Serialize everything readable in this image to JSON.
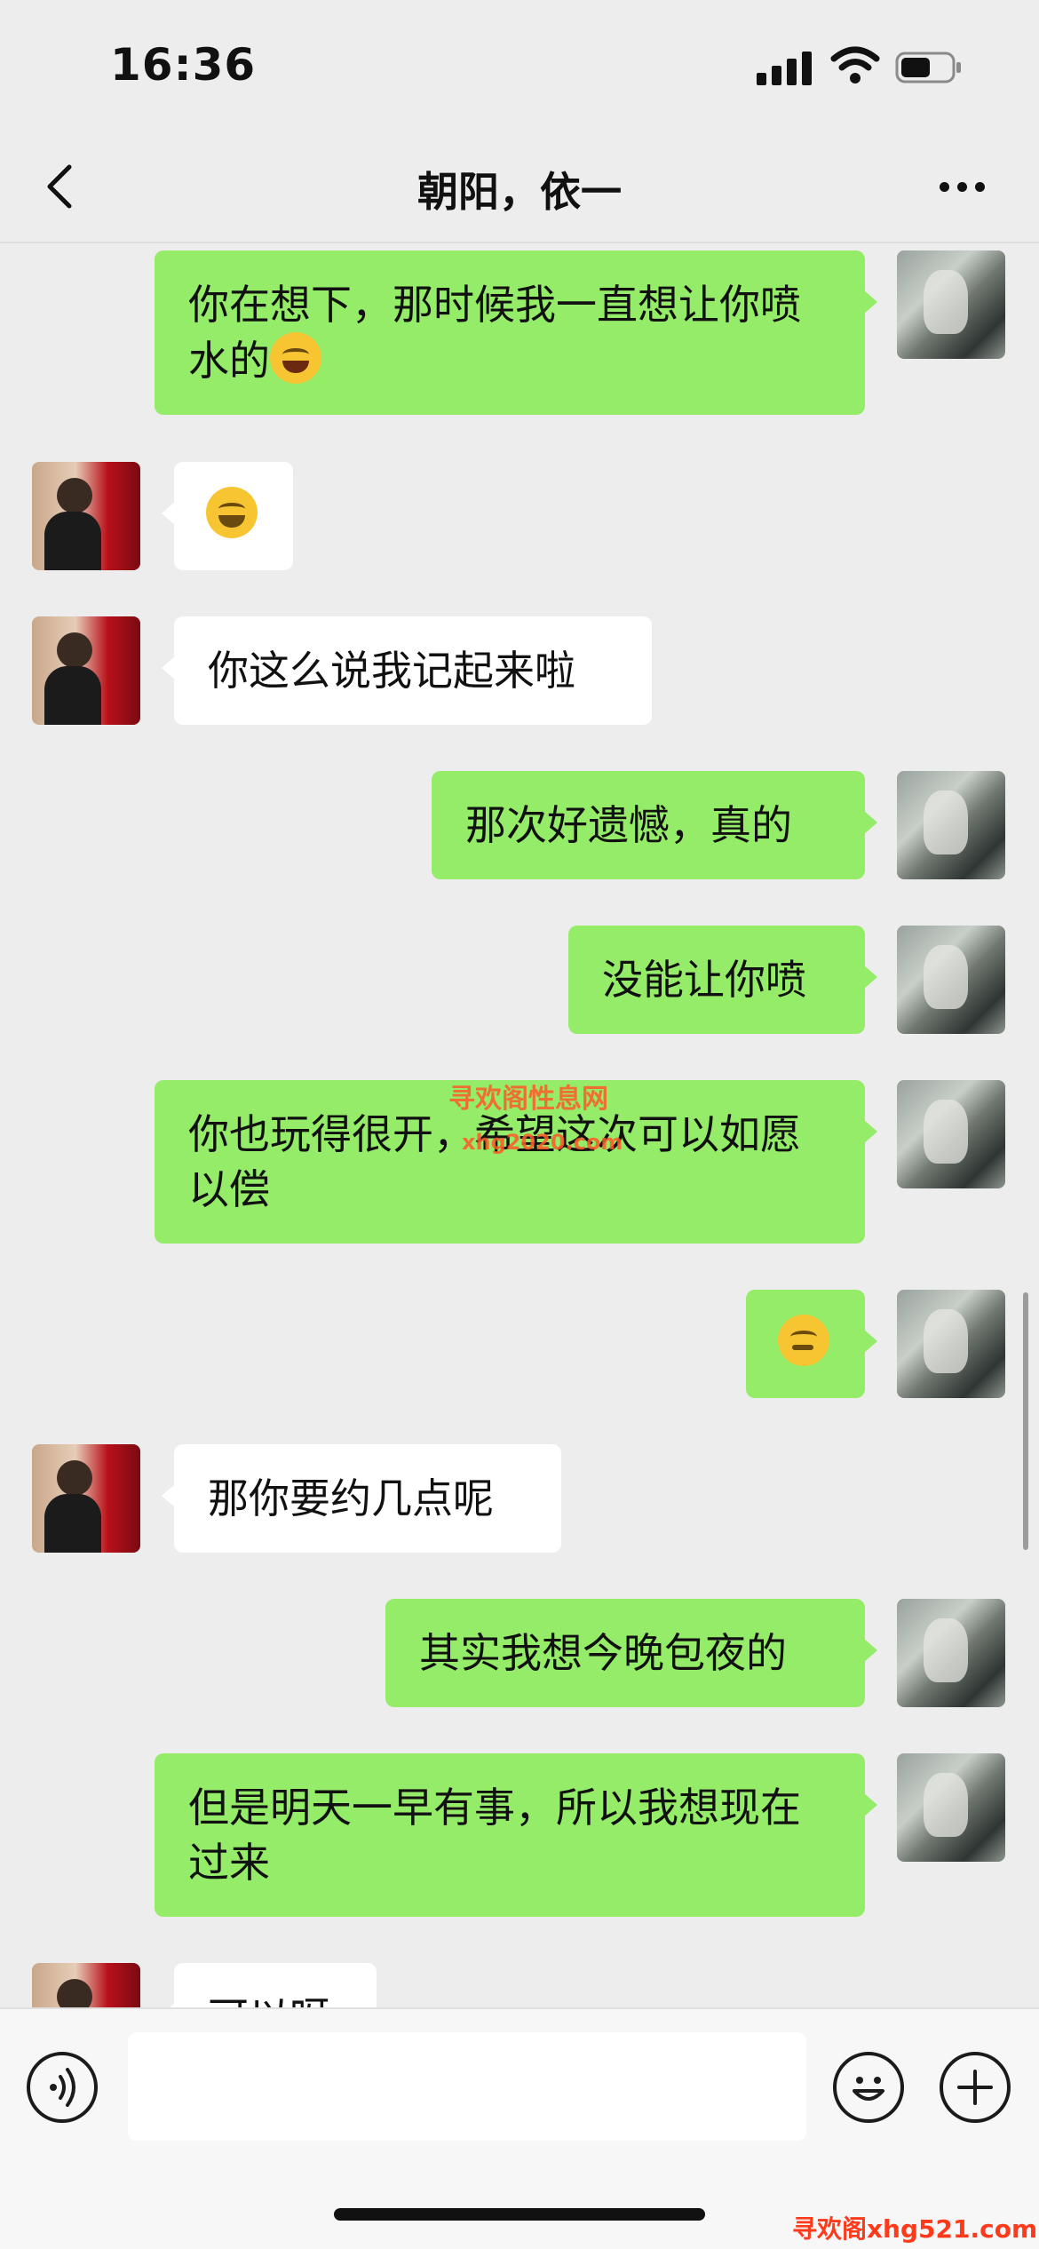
{
  "status_bar": {
    "time": "16:36"
  },
  "nav": {
    "title": "朝阳，依一",
    "back_icon": "chevron-left-icon",
    "more_icon": "more-dots-icon"
  },
  "messages": [
    {
      "from": "me",
      "text": "你在想下，那时候我一直想让你喷水的",
      "emoji": "crying-laughing-face"
    },
    {
      "from": "her",
      "text": "",
      "emoji": "laughing-tears-face"
    },
    {
      "from": "her",
      "text": "你这么说我记起来啦"
    },
    {
      "from": "me",
      "text": "那次好遗憾，真的"
    },
    {
      "from": "me",
      "text": "没能让你喷"
    },
    {
      "from": "me",
      "text": "你也玩得很开，希望这次可以如愿以偿"
    },
    {
      "from": "me",
      "text": "",
      "emoji": "face-with-hand-over-mouth"
    },
    {
      "from": "her",
      "text": "那你要约几点呢"
    },
    {
      "from": "me",
      "text": "其实我想今晚包夜的"
    },
    {
      "from": "me",
      "text": "但是明天一早有事，所以我想现在过来"
    },
    {
      "from": "her",
      "text": "可以呀"
    }
  ],
  "watermark": {
    "line1": "寻欢阁性息网",
    "line2": "xhg2020.com",
    "corner": "寻欢阁xhg521.com"
  },
  "input_bar": {
    "placeholder": ""
  },
  "colors": {
    "my_bubble": "#95ec69",
    "her_bubble": "#ffffff",
    "background": "#ededed"
  }
}
